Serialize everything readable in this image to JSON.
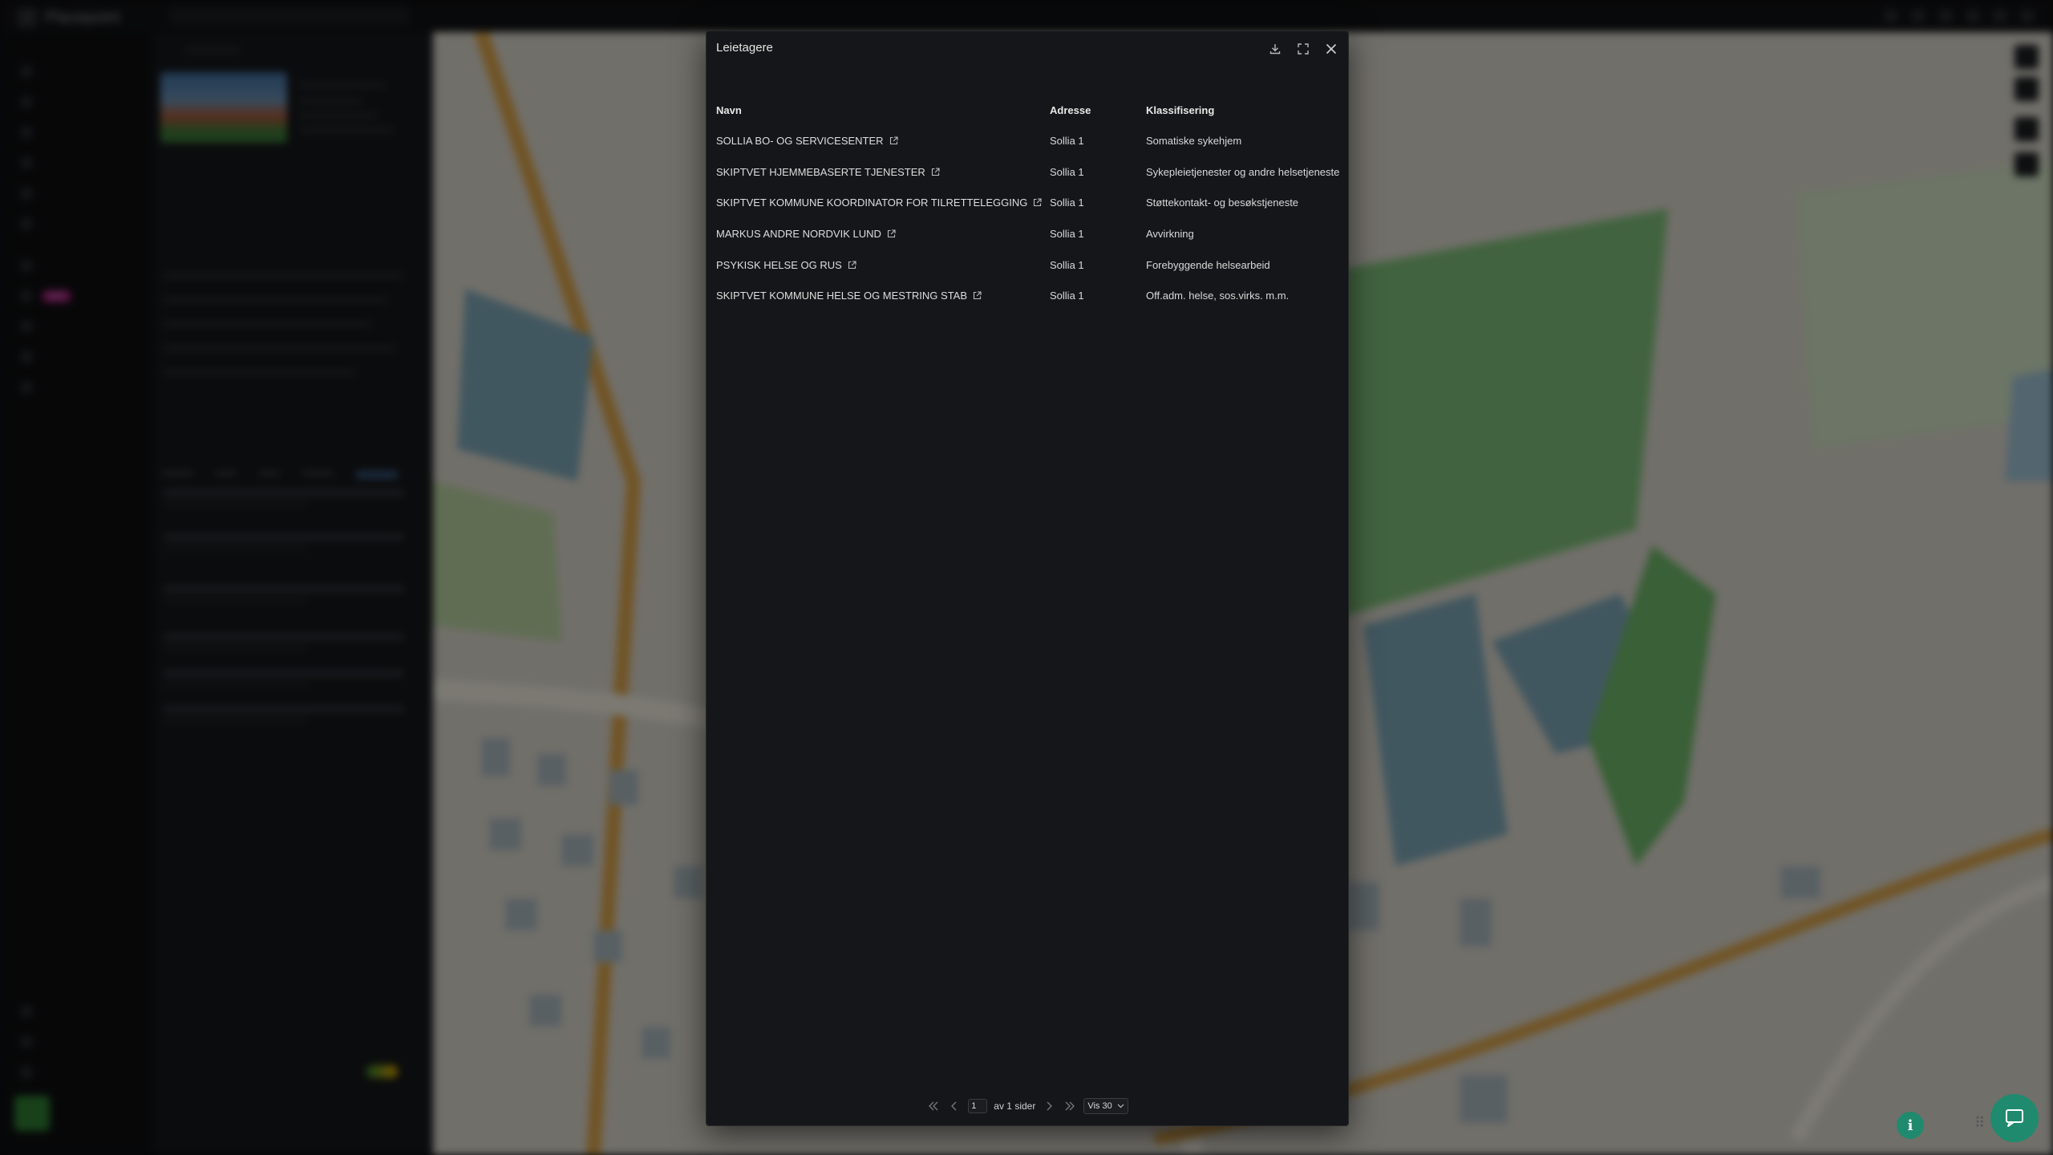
{
  "modal": {
    "title": "Leietagere",
    "columns": {
      "name": "Navn",
      "address": "Adresse",
      "classification": "Klassifisering"
    },
    "rows": [
      {
        "name": "SOLLIA BO- OG SERVICESENTER",
        "address": "Sollia 1",
        "classification": "Somatiske sykehjem"
      },
      {
        "name": "SKIPTVET HJEMMEBASERTE TJENESTER",
        "address": "Sollia 1",
        "classification": "Sykepleietjenester og andre helsetjeneste"
      },
      {
        "name": "SKIPTVET KOMMUNE KOORDINATOR FOR TILRETTELEGGING",
        "address": "Sollia 1",
        "classification": "Støttekontakt- og besøkstjeneste"
      },
      {
        "name": "MARKUS ANDRE NORDVIK LUND",
        "address": "Sollia 1",
        "classification": "Avvirkning"
      },
      {
        "name": "PSYKISK HELSE OG RUS",
        "address": "Sollia 1",
        "classification": "Forebyggende helsearbeid"
      },
      {
        "name": "SKIPTVET KOMMUNE HELSE OG MESTRING STAB",
        "address": "Sollia 1",
        "classification": "Off.adm. helse, sos.virks. m.m."
      }
    ],
    "pagination": {
      "page": "1",
      "of_label": "av 1 sider",
      "page_size": "Vis 30"
    }
  },
  "background": {
    "brand": "Placepoint",
    "nav_badge": "NEW"
  },
  "icons": {
    "download": "download-icon",
    "fullscreen": "fullscreen-icon",
    "close": "close-icon",
    "external": "external-link-icon",
    "chat": "chat-icon",
    "info": "info-icon"
  },
  "colors": {
    "accent": "#1f8a6e",
    "modal_bg": "#151619"
  }
}
